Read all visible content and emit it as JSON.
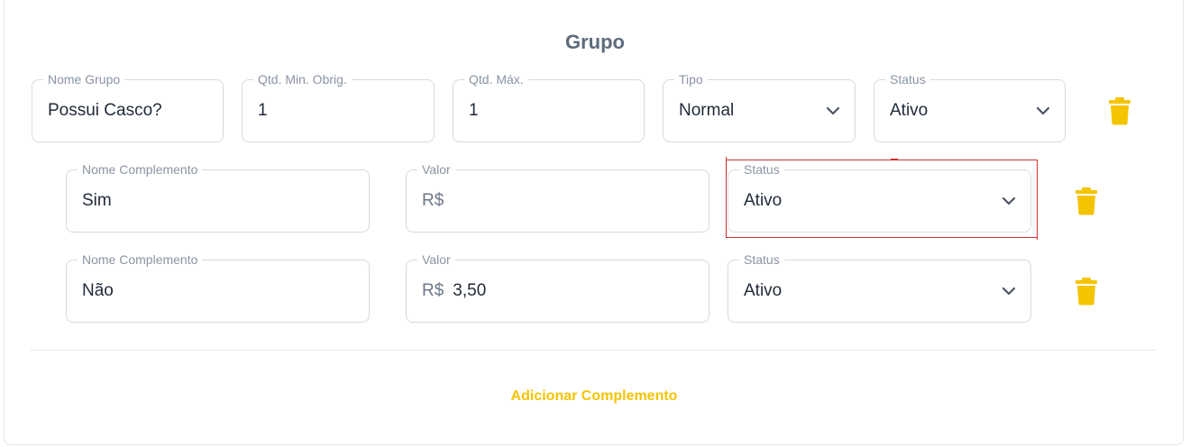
{
  "group": {
    "title": "Grupo",
    "nome_grupo": {
      "label": "Nome Grupo",
      "value": "Possui Casco?"
    },
    "qtd_min": {
      "label": "Qtd. Min. Obrig.",
      "value": "1"
    },
    "qtd_max": {
      "label": "Qtd. Máx.",
      "value": "1"
    },
    "tipo": {
      "label": "Tipo",
      "value": "Normal"
    },
    "status": {
      "label": "Status",
      "value": "Ativo"
    }
  },
  "complementos": [
    {
      "nome": {
        "label": "Nome Complemento",
        "value": "Sim"
      },
      "valor": {
        "label": "Valor",
        "prefix": "R$",
        "value": ""
      },
      "status": {
        "label": "Status",
        "value": "Ativo"
      }
    },
    {
      "nome": {
        "label": "Nome Complemento",
        "value": "Não"
      },
      "valor": {
        "label": "Valor",
        "prefix": "R$",
        "value": "3,50"
      },
      "status": {
        "label": "Status",
        "value": "Ativo"
      }
    }
  ],
  "actions": {
    "add_label": "Adicionar Complemento"
  },
  "icons": {
    "delete": "trash-icon",
    "dropdown": "chevron-down-icon"
  },
  "colors": {
    "accent": "#f5c400",
    "highlight": "#d12c2c",
    "title": "#5d6b7c"
  }
}
